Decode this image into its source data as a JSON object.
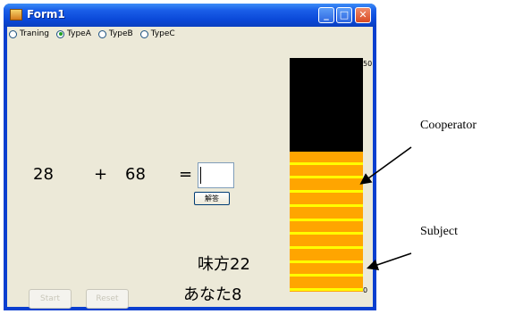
{
  "window": {
    "title": "Form1",
    "min_symbol": "_",
    "max_symbol": "□",
    "close_symbol": "✕"
  },
  "mode_options": [
    {
      "label": "Traning",
      "selected": false
    },
    {
      "label": "TypeA",
      "selected": true
    },
    {
      "label": "TypeB",
      "selected": false
    },
    {
      "label": "TypeC",
      "selected": false
    }
  ],
  "problem": {
    "operand1": "28",
    "operator": "+",
    "operand2": "68",
    "equals": "=",
    "answer_value": ""
  },
  "answer_button_label": "解答",
  "status": {
    "cooperator_line": "味方22",
    "subject_line": "あなた8"
  },
  "bottom_buttons": {
    "start_label": "Start",
    "reset_label": "Reset"
  },
  "gauge": {
    "max_label": "50",
    "min_label": "0",
    "max_value": 50,
    "filled_value": 30,
    "segment_count": 10
  },
  "colors": {
    "gauge_fill": "#ffa500",
    "gauge_divider": "#ffff00",
    "gauge_empty": "#000000",
    "form_bg": "#ece9d8"
  },
  "annotations": {
    "cooperator": "Cooperator",
    "subject": "Subject"
  }
}
